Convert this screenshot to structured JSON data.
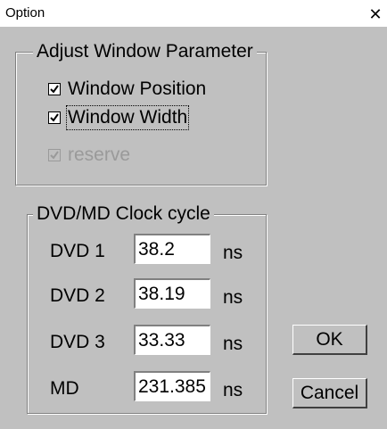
{
  "window": {
    "title": "Option",
    "close_glyph": "✕"
  },
  "adjust_group": {
    "title": "Adjust Window Parameter",
    "options": [
      {
        "label": "Window Position",
        "checked": true,
        "enabled": true,
        "focused": false
      },
      {
        "label": "Window Width",
        "checked": true,
        "enabled": true,
        "focused": true
      },
      {
        "label": "reserve",
        "checked": true,
        "enabled": false,
        "focused": false
      }
    ]
  },
  "clock_group": {
    "title": "DVD/MD Clock cycle",
    "fields": [
      {
        "label": "DVD 1",
        "value": "38.2",
        "unit": "ns"
      },
      {
        "label": "DVD 2",
        "value": "38.19",
        "unit": "ns"
      },
      {
        "label": "DVD 3",
        "value": "33.33",
        "unit": "ns"
      },
      {
        "label": "MD",
        "value": "231.385",
        "unit": "ns"
      }
    ]
  },
  "buttons": {
    "ok": "OK",
    "cancel": "Cancel"
  },
  "colors": {
    "face": "#c0c0c0",
    "shadow": "#808080",
    "highlight": "#ffffff",
    "disabled_text": "#9a9a9a"
  }
}
